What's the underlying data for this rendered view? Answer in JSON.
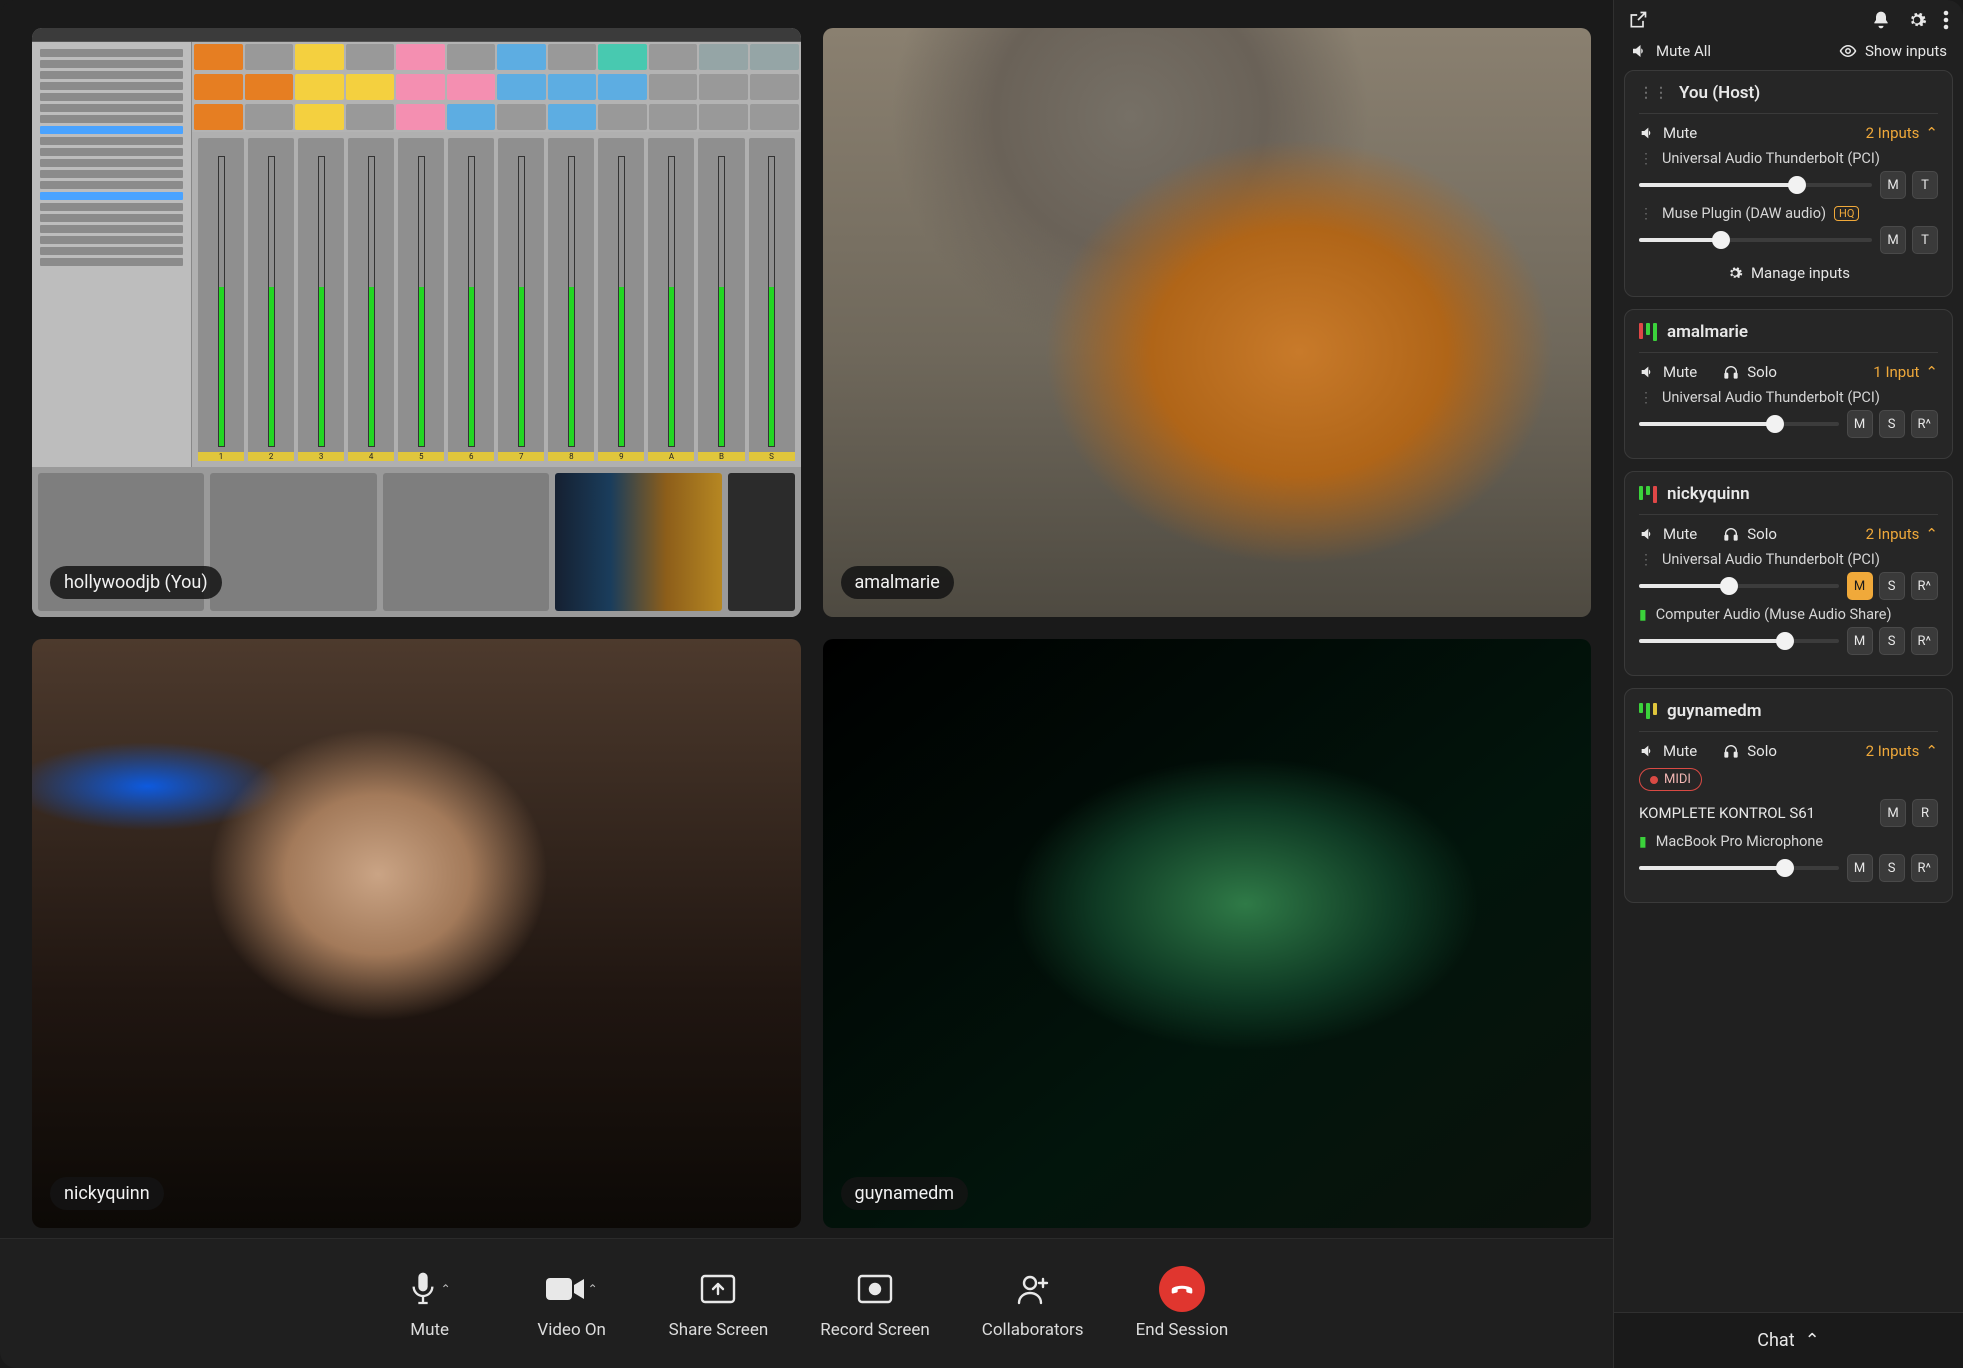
{
  "tiles": [
    {
      "id": "hollywoodjb",
      "label": "hollywoodjb (You)"
    },
    {
      "id": "amalmarie",
      "label": "amalmarie"
    },
    {
      "id": "nickyquinn",
      "label": "nickyquinn"
    },
    {
      "id": "guynamedm",
      "label": "guynamedm"
    }
  ],
  "controls": {
    "mute": "Mute",
    "video_on": "Video On",
    "share_screen": "Share Screen",
    "record_screen": "Record Screen",
    "collaborators": "Collaborators",
    "end_session": "End Session"
  },
  "topbar": {
    "mute_all": "Mute All",
    "show_inputs": "Show inputs"
  },
  "cards": {
    "you": {
      "title": "You (Host)",
      "mute": "Mute",
      "inputs_tag": "2 Inputs",
      "input1": "Universal Audio Thunderbolt (PCI)",
      "input2": "Muse Plugin (DAW audio)",
      "hq": "HQ",
      "manage": "Manage inputs",
      "slider1": 68,
      "slider2": 35,
      "chips1": [
        "M",
        "T"
      ],
      "chips2": [
        "M",
        "T"
      ]
    },
    "amalmarie": {
      "title": "amalmarie",
      "mute": "Mute",
      "solo": "Solo",
      "inputs_tag": "1 Input",
      "input1": "Universal Audio Thunderbolt (PCI)",
      "slider1": 68,
      "chips1": [
        "M",
        "S",
        "R^"
      ]
    },
    "nickyquinn": {
      "title": "nickyquinn",
      "mute": "Mute",
      "solo": "Solo",
      "inputs_tag": "2 Inputs",
      "input1": "Universal Audio Thunderbolt (PCI)",
      "input2": "Computer Audio (Muse Audio Share)",
      "slider1": 45,
      "slider2": 73,
      "chips1": [
        "M",
        "S",
        "R^"
      ],
      "chips1_active": 0,
      "chips2": [
        "M",
        "S",
        "R^"
      ]
    },
    "guynamedm": {
      "title": "guynamedm",
      "mute": "Mute",
      "solo": "Solo",
      "inputs_tag": "2 Inputs",
      "midi": "MIDI",
      "input1": "KOMPLETE KONTROL S61",
      "input2": "MacBook Pro Microphone",
      "slider2": 73,
      "chips1": [
        "M",
        "R"
      ],
      "chips2": [
        "M",
        "S",
        "R^"
      ]
    }
  },
  "chat": "Chat",
  "daw_colors": {
    "orange": "#e67e22",
    "yellow": "#f4d03f",
    "pink": "#f48fb1",
    "blue": "#5dade2",
    "teal": "#48c9b0",
    "grey": "#95a5a6"
  }
}
